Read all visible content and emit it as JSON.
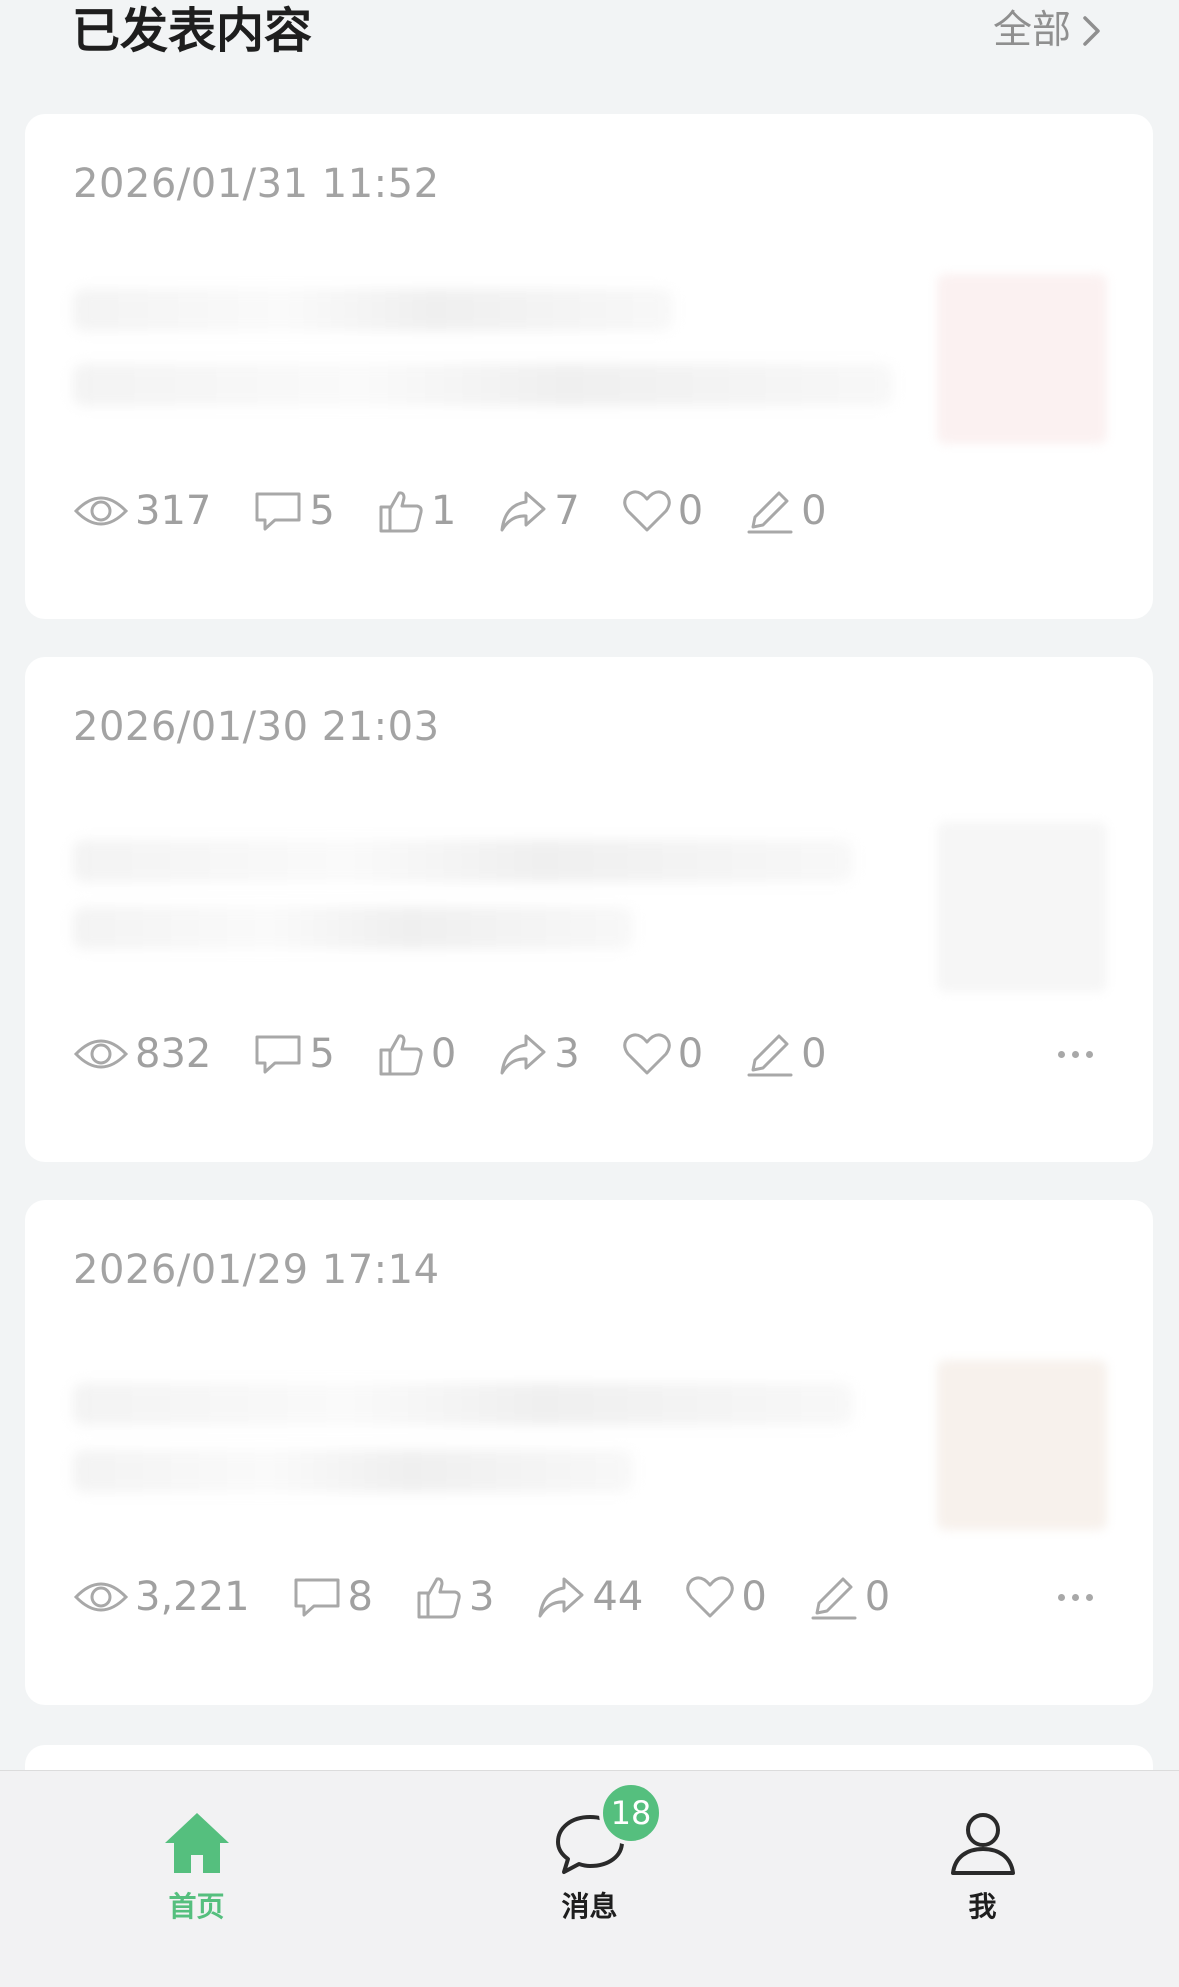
{
  "header": {
    "title": "已发表内容",
    "all_label": "全部"
  },
  "posts": [
    {
      "date": "2026/01/31 11:52",
      "views": "317",
      "comments": "5",
      "likes": "1",
      "shares": "7",
      "favorites": "0",
      "edits": "0"
    },
    {
      "date": "2026/01/30 21:03",
      "views": "832",
      "comments": "5",
      "likes": "0",
      "shares": "3",
      "favorites": "0",
      "edits": "0"
    },
    {
      "date": "2026/01/29 17:14",
      "views": "3,221",
      "comments": "8",
      "likes": "3",
      "shares": "44",
      "favorites": "0",
      "edits": "0"
    }
  ],
  "tabbar": {
    "home_label": "首页",
    "messages_label": "消息",
    "messages_badge": "18",
    "me_label": "我",
    "active_color": "#55bf7e"
  },
  "icons": [
    "chevron-right-icon",
    "eye-icon",
    "comment-icon",
    "thumbs-up-icon",
    "share-icon",
    "heart-icon",
    "edit-icon",
    "more-icon",
    "home-icon",
    "chat-bubble-icon",
    "user-icon"
  ]
}
